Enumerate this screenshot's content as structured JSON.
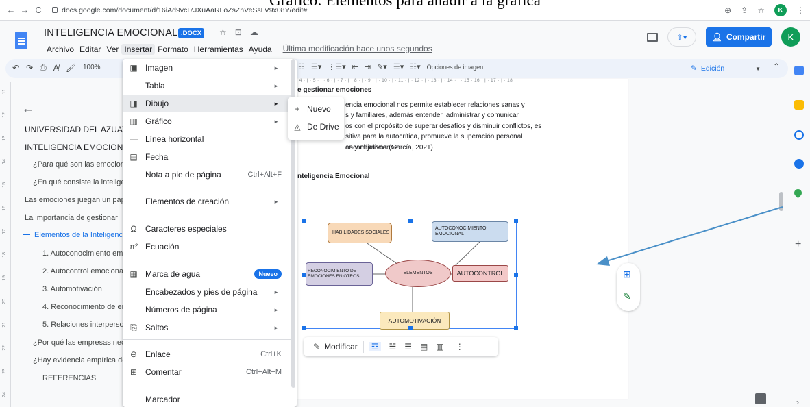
{
  "caption": "Gráfico: Elementos para añadir a la gráfica",
  "browser": {
    "url": "docs.google.com/document/d/16iAd9vcI7JXuAaRLoZsZnVeSsLV9x08Y/edit#",
    "avatar": "K"
  },
  "doc": {
    "title": "INTELIGENCIA EMOCIONAL",
    "badge": ".DOCX",
    "menus": [
      "Archivo",
      "Editar",
      "Ver",
      "Insertar",
      "Formato",
      "Herramientas",
      "Ayuda"
    ],
    "last_modified": "Última modificación hace unos segundos",
    "share_label": "Compartir",
    "avatar": "K"
  },
  "toolbar": {
    "zoom": "100%",
    "image_options": "Opciones de imagen",
    "mode": "Edición",
    "ruler_marks": "· 4 · | · 5 · | · 6 · | · 7 · | · 8 · | · 9 · | · 10 · | · 11 · | · 12 · | · 13 · | · 14 · | · 15 · 16 · | · 17 · | · 18"
  },
  "vruler": [
    "11",
    "12",
    "13",
    "14",
    "15",
    "16",
    "17",
    "18",
    "19",
    "20",
    "21",
    "22",
    "23",
    "24",
    "25"
  ],
  "outline": {
    "items": [
      {
        "text": "UNIVERSIDAD DEL AZUAY",
        "level": "h"
      },
      {
        "text": "INTELIGENCIA EMOCIONAL",
        "level": "h"
      },
      {
        "text": "¿Para qué son las emociones?",
        "level": "1"
      },
      {
        "text": "¿En qué consiste la inteligencia emocional?",
        "level": "1"
      },
      {
        "text": "Las emociones juegan un papel",
        "level": "1"
      },
      {
        "text": "La importancia de gestionar",
        "level": "1"
      },
      {
        "text": "Elementos de la Inteligencia Emocional",
        "level": "active"
      },
      {
        "text": "1. Autoconocimiento emocional",
        "level": "2"
      },
      {
        "text": "2. Autocontrol emocional",
        "level": "2"
      },
      {
        "text": "3. Automotivación",
        "level": "2"
      },
      {
        "text": "4. Reconocimiento de emociones",
        "level": "2"
      },
      {
        "text": "5. Relaciones interpersonales",
        "level": "2"
      },
      {
        "text": "¿Por qué las empresas necesitan",
        "level": "1"
      },
      {
        "text": "¿Hay evidencia empírica de",
        "level": "1"
      },
      {
        "text": "REFERENCIAS",
        "level": "2"
      }
    ]
  },
  "page": {
    "heading": "e gestionar emociones",
    "para_lines": [
      "encia emocional nos permite establecer relaciones sanas y",
      "s y familiares, además entender, administrar y comunicar",
      "os con el propósito de superar desafíos y disminuir conflictos, es",
      "sitiva para la autocrítica, promueve la superación personal encaminándonos",
      "as y objetivos (García, 2021)"
    ],
    "section_heading": "nteligencia Emocional"
  },
  "mindmap": {
    "center": "ELEMENTOS",
    "nodes": {
      "social": "HABILIDADES SOCIALES",
      "awareness": "AUTOCONOCIMIENTO EMOCIONAL",
      "recognition": "RECONOCIMIENTO DE EMOCIONES EN OTROS",
      "control": "AUTOCONTROL",
      "motivation": "AUTOMOTIVACIÓN"
    },
    "colors": {
      "social": "#f8d9b8",
      "awareness": "#cbdcef",
      "recognition": "#d4cfe3",
      "control": "#f3c8c8",
      "motivation": "#fbe9bd",
      "center": "#f0c9c9"
    }
  },
  "image_toolbar": {
    "modify": "Modificar"
  },
  "menu": {
    "items": [
      {
        "icon": "image-icon",
        "glyph": "▣",
        "label": "Imagen",
        "arrow": true
      },
      {
        "icon": "",
        "glyph": "",
        "label": "Tabla",
        "arrow": true
      },
      {
        "icon": "drawing-icon",
        "glyph": "◨",
        "label": "Dibujo",
        "arrow": true,
        "highlight": true
      },
      {
        "icon": "chart-icon",
        "glyph": "▥",
        "label": "Gráfico",
        "arrow": true
      },
      {
        "icon": "horizontal-line-icon",
        "glyph": "—",
        "label": "Línea horizontal"
      },
      {
        "icon": "date-icon",
        "glyph": "▤",
        "label": "Fecha"
      },
      {
        "icon": "",
        "glyph": "",
        "label": "Nota a pie de página",
        "shortcut": "Ctrl+Alt+F"
      },
      {
        "icon": "",
        "glyph": "",
        "label": "Elementos de creación",
        "arrow": true
      },
      {
        "icon": "omega-icon",
        "glyph": "Ω",
        "label": "Caracteres especiales"
      },
      {
        "icon": "pi-icon",
        "glyph": "π²",
        "label": "Ecuación"
      },
      {
        "icon": "watermark-icon",
        "glyph": "▦",
        "label": "Marca de agua",
        "badge": "Nuevo"
      },
      {
        "icon": "",
        "glyph": "",
        "label": "Encabezados y pies de página",
        "arrow": true
      },
      {
        "icon": "",
        "glyph": "",
        "label": "Números de página",
        "arrow": true
      },
      {
        "icon": "page-break-icon",
        "glyph": "⎘",
        "label": "Saltos",
        "arrow": true
      },
      {
        "icon": "link-icon",
        "glyph": "⊖",
        "label": "Enlace",
        "shortcut": "Ctrl+K"
      },
      {
        "icon": "comment-add-icon",
        "glyph": "⊞",
        "label": "Comentar",
        "shortcut": "Ctrl+Alt+M"
      },
      {
        "icon": "",
        "glyph": "",
        "label": "Marcador"
      }
    ]
  },
  "submenu": {
    "items": [
      {
        "glyph": "+",
        "label": "Nuevo"
      },
      {
        "glyph": "◬",
        "label": "De Drive"
      }
    ]
  }
}
